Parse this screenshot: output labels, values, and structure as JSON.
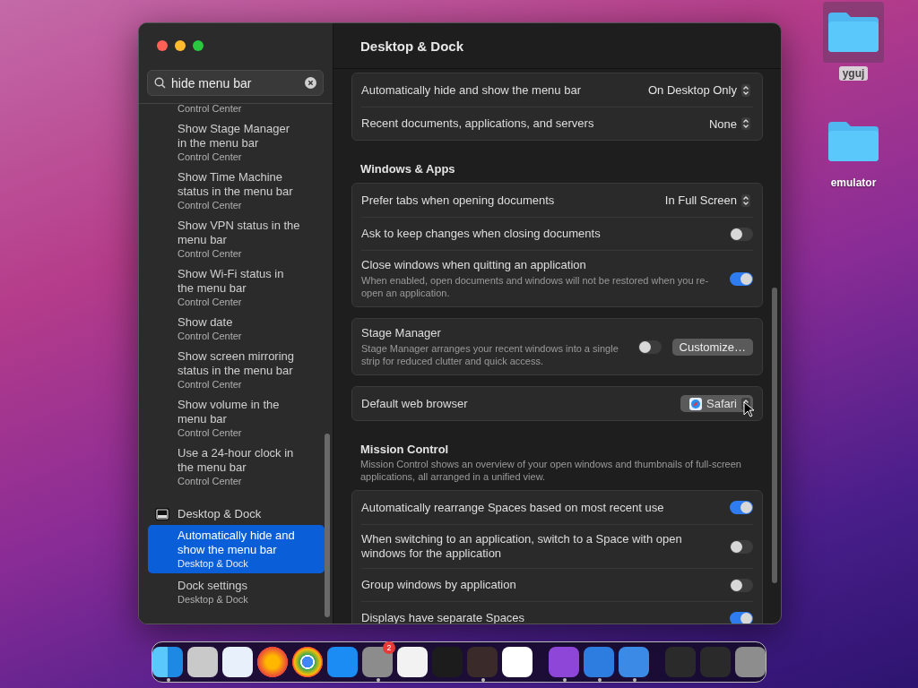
{
  "desktop_icons": [
    {
      "label": "yguj",
      "selected": true
    },
    {
      "label": "emulator",
      "selected": false
    }
  ],
  "window": {
    "title": "Desktop & Dock"
  },
  "sidebar": {
    "search": {
      "value": "hide menu bar"
    },
    "results": [
      {
        "kind": "result",
        "subtitle": "Control Center",
        "selected": false
      },
      {
        "kind": "result",
        "title": "Show Stage Manager in the menu bar",
        "subtitle": "Control Center",
        "selected": false
      },
      {
        "kind": "result",
        "title": "Show Time Machine status in the menu bar",
        "subtitle": "Control Center",
        "selected": false
      },
      {
        "kind": "result",
        "title": "Show VPN status in the menu bar",
        "subtitle": "Control Center",
        "selected": false
      },
      {
        "kind": "result",
        "title": "Show Wi-Fi status in the menu bar",
        "subtitle": "Control Center",
        "selected": false
      },
      {
        "kind": "result",
        "title": "Show date",
        "subtitle": "Control Center",
        "selected": false
      },
      {
        "kind": "result",
        "title": "Show screen mirroring status in the menu bar",
        "subtitle": "Control Center",
        "selected": false
      },
      {
        "kind": "result",
        "title": "Show volume in the menu bar",
        "subtitle": "Control Center",
        "selected": false
      },
      {
        "kind": "result",
        "title": "Use a 24-hour clock in the menu bar",
        "subtitle": "Control Center",
        "selected": false
      },
      {
        "kind": "header",
        "title": "Desktop & Dock"
      },
      {
        "kind": "result",
        "title": "Automatically hide and show the menu bar",
        "subtitle": "Desktop & Dock",
        "selected": true
      },
      {
        "kind": "result",
        "title": "Dock settings",
        "subtitle": "Desktop & Dock",
        "selected": false
      }
    ]
  },
  "sections": [
    {
      "rows": [
        {
          "kind": "popup",
          "label": "Automatically hide and show the menu bar",
          "value": "On Desktop Only"
        },
        {
          "kind": "popup",
          "label": "Recent documents, applications, and servers",
          "value": "None"
        }
      ]
    },
    {
      "heading": "Windows & Apps",
      "rows": [
        {
          "kind": "popup",
          "label": "Prefer tabs when opening documents",
          "value": "In Full Screen"
        },
        {
          "kind": "toggle",
          "label": "Ask to keep changes when closing documents",
          "on": false
        },
        {
          "kind": "toggle",
          "label": "Close windows when quitting an application",
          "description": "When enabled, open documents and windows will not be restored when you re-open an application.",
          "on": true
        }
      ]
    },
    {
      "rows": [
        {
          "kind": "toggle-button",
          "label": "Stage Manager",
          "description": "Stage Manager arranges your recent windows into a single strip for reduced clutter and quick access.",
          "on": false,
          "button": "Customize…"
        }
      ]
    },
    {
      "rows": [
        {
          "kind": "app-popup",
          "label": "Default web browser",
          "value": "Safari"
        }
      ]
    },
    {
      "heading": "Mission Control",
      "description": "Mission Control shows an overview of your open windows and thumbnails of full-screen applications, all arranged in a unified view.",
      "rows": [
        {
          "kind": "toggle",
          "label": "Automatically rearrange Spaces based on most recent use",
          "on": true
        },
        {
          "kind": "toggle",
          "label": "When switching to an application, switch to a Space with open windows for the application",
          "on": false
        },
        {
          "kind": "toggle",
          "label": "Group windows by application",
          "on": false
        },
        {
          "kind": "toggle",
          "label": "Displays have separate Spaces",
          "on": true
        }
      ]
    }
  ],
  "dock": [
    {
      "kind": "finder",
      "running": true
    },
    {
      "kind": "launchpad",
      "running": false
    },
    {
      "kind": "safari",
      "running": false
    },
    {
      "kind": "firefox",
      "running": false
    },
    {
      "kind": "chrome",
      "running": false
    },
    {
      "kind": "appstore",
      "running": false
    },
    {
      "kind": "settings",
      "running": true,
      "badge": "2"
    },
    {
      "kind": "textedit",
      "running": false
    },
    {
      "kind": "terminal",
      "running": false
    },
    {
      "kind": "garageband",
      "running": true
    },
    {
      "kind": "vscode",
      "running": false
    },
    {
      "kind": "separator"
    },
    {
      "kind": "configurator",
      "running": true
    },
    {
      "kind": "xcode",
      "running": true
    },
    {
      "kind": "instruments",
      "running": true
    },
    {
      "kind": "separator"
    },
    {
      "kind": "thumbnail",
      "running": false
    },
    {
      "kind": "thumbnail",
      "running": false
    },
    {
      "kind": "trash",
      "running": false
    }
  ]
}
